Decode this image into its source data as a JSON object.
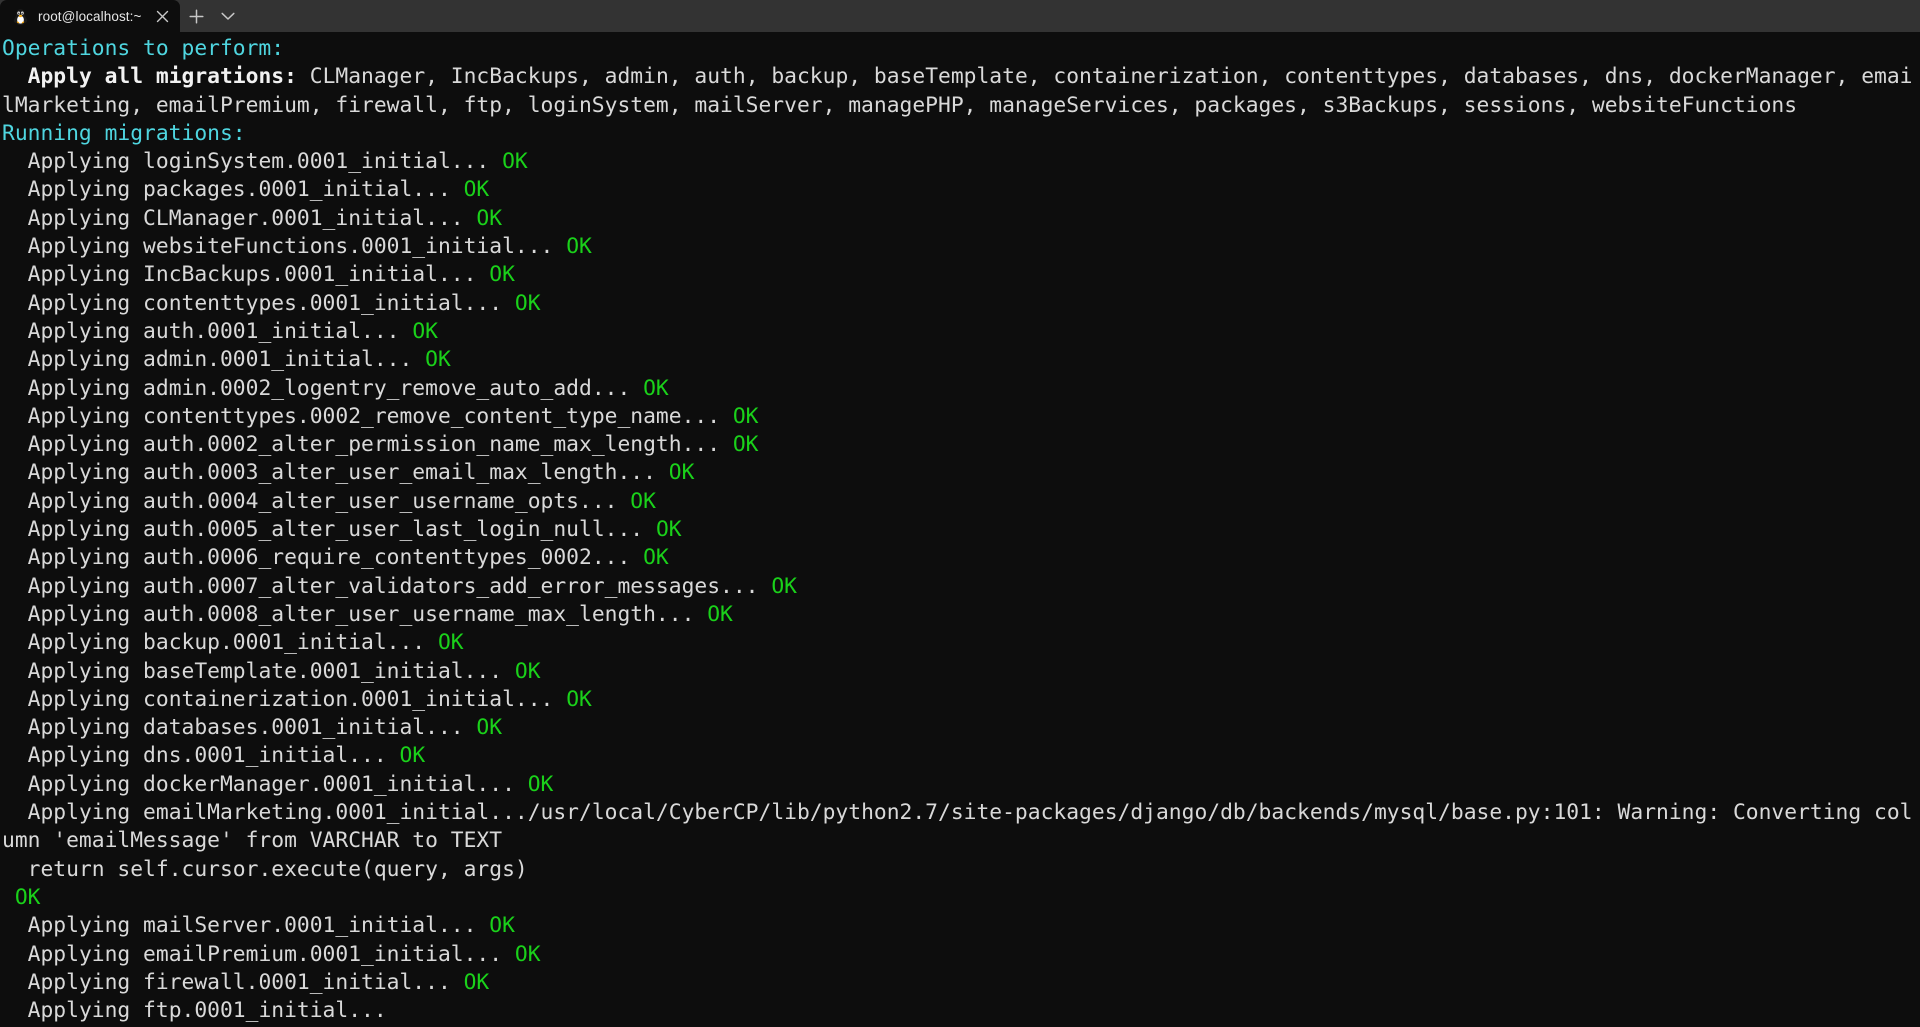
{
  "window": {
    "title": "root@localhost:~"
  },
  "tabbar": {
    "tab_title": "root@localhost:~",
    "os_icon": "tux-penguin-icon",
    "close_icon": "close-icon",
    "new_tab_icon": "plus-icon",
    "tab_menu_icon": "chevron-down-icon",
    "background": "#333333",
    "active_tab_background": "#0d0d0d"
  },
  "theme": {
    "background": "#0d0d0d",
    "foreground": "#d4d4d4",
    "cyan": "#4fd6e0",
    "green": "#1ad11a",
    "bright_white": "#f2f2f2"
  },
  "terminal": {
    "heading_operations": "Operations to perform:",
    "apply_label": "  Apply all migrations: ",
    "apply_modules": "CLManager, IncBackups, admin, auth, backup, baseTemplate, containerization, contenttypes, databases, dns, dockerManager, emailMarketing, emailPremium, firewall, ftp, loginSystem, mailServer, managePHP, manageServices, packages, s3Backups, sessions, websiteFunctions",
    "heading_running": "Running migrations:",
    "applying_prefix": "  Applying ",
    "ellipsis": "... ",
    "ok_label": "OK",
    "migrations": [
      {
        "name": "loginSystem.0001_initial",
        "status": "OK"
      },
      {
        "name": "packages.0001_initial",
        "status": "OK"
      },
      {
        "name": "CLManager.0001_initial",
        "status": "OK"
      },
      {
        "name": "websiteFunctions.0001_initial",
        "status": "OK"
      },
      {
        "name": "IncBackups.0001_initial",
        "status": "OK"
      },
      {
        "name": "contenttypes.0001_initial",
        "status": "OK"
      },
      {
        "name": "auth.0001_initial",
        "status": "OK"
      },
      {
        "name": "admin.0001_initial",
        "status": "OK"
      },
      {
        "name": "admin.0002_logentry_remove_auto_add",
        "status": "OK"
      },
      {
        "name": "contenttypes.0002_remove_content_type_name",
        "status": "OK"
      },
      {
        "name": "auth.0002_alter_permission_name_max_length",
        "status": "OK"
      },
      {
        "name": "auth.0003_alter_user_email_max_length",
        "status": "OK"
      },
      {
        "name": "auth.0004_alter_user_username_opts",
        "status": "OK"
      },
      {
        "name": "auth.0005_alter_user_last_login_null",
        "status": "OK"
      },
      {
        "name": "auth.0006_require_contenttypes_0002",
        "status": "OK"
      },
      {
        "name": "auth.0007_alter_validators_add_error_messages",
        "status": "OK"
      },
      {
        "name": "auth.0008_alter_user_username_max_length",
        "status": "OK"
      },
      {
        "name": "backup.0001_initial",
        "status": "OK"
      },
      {
        "name": "baseTemplate.0001_initial",
        "status": "OK"
      },
      {
        "name": "containerization.0001_initial",
        "status": "OK"
      },
      {
        "name": "databases.0001_initial",
        "status": "OK"
      },
      {
        "name": "dns.0001_initial",
        "status": "OK"
      },
      {
        "name": "dockerManager.0001_initial",
        "status": "OK"
      }
    ],
    "warning_block": {
      "applying_line": "  Applying emailMarketing.0001_initial...",
      "warning_path": "/usr/local/CyberCP/lib/python2.7/site-packages/django/db/backends/mysql/base.py:101: Warning: Converting column 'emailMessage' from VARCHAR to TEXT",
      "warning_trace": "  return self.cursor.execute(query, args)",
      "warning_status": " OK"
    },
    "migrations_after_warning": [
      {
        "name": "mailServer.0001_initial",
        "status": "OK"
      },
      {
        "name": "emailPremium.0001_initial",
        "status": "OK"
      },
      {
        "name": "firewall.0001_initial",
        "status": "OK"
      }
    ],
    "in_progress": {
      "name": "ftp.0001_initial",
      "status": ""
    }
  }
}
